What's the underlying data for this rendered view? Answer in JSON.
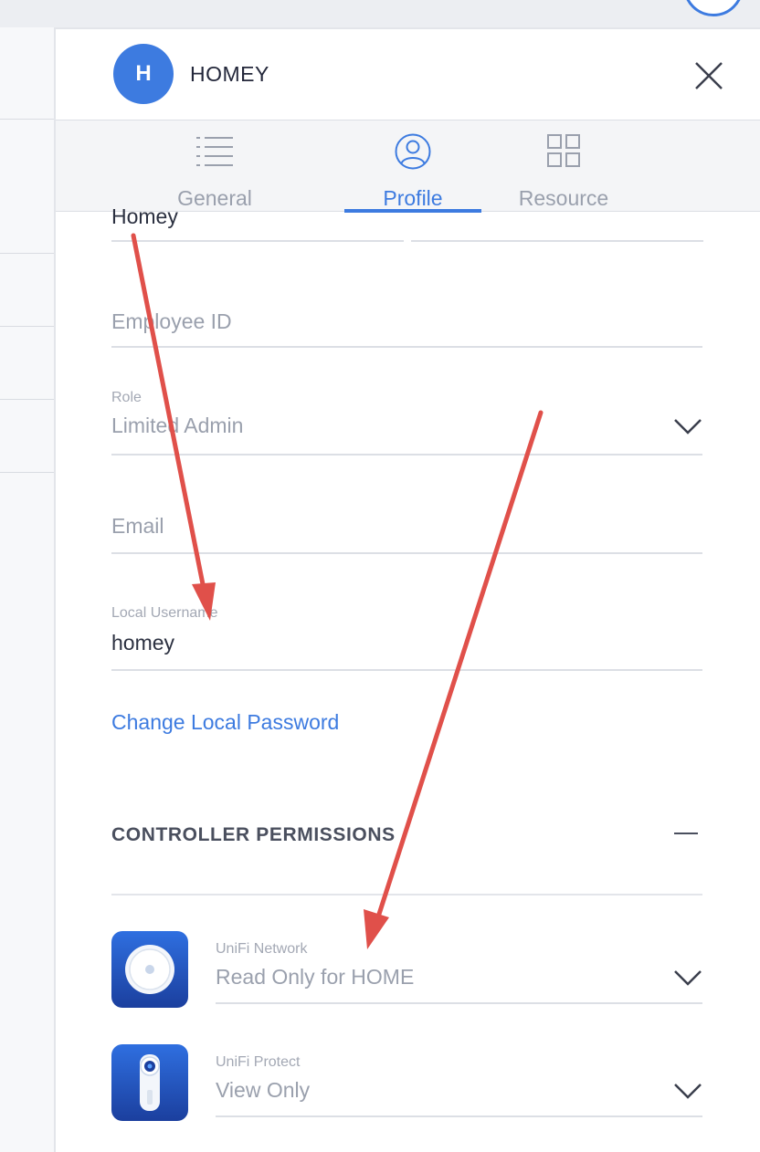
{
  "header": {
    "avatar_initial": "H",
    "title": "HOMEY"
  },
  "tabs": [
    {
      "label": "General",
      "icon": "list-icon",
      "active": false
    },
    {
      "label": "Profile",
      "icon": "person-icon",
      "active": true
    },
    {
      "label": "Resource",
      "icon": "grid-icon",
      "active": false
    }
  ],
  "form": {
    "name_value": "Homey",
    "employee_id": {
      "placeholder": "Employee ID"
    },
    "role": {
      "label": "Role",
      "value": "Limited Admin"
    },
    "email": {
      "placeholder": "Email"
    },
    "local_username": {
      "label": "Local Username",
      "value": "homey"
    },
    "change_password_link": "Change Local Password"
  },
  "permissions": {
    "section_title": "CONTROLLER PERMISSIONS",
    "items": [
      {
        "app": "UniFi Network",
        "value": "Read Only for HOME",
        "icon": "unifi-network-icon"
      },
      {
        "app": "UniFi Protect",
        "value": "View Only",
        "icon": "unifi-protect-icon"
      }
    ]
  },
  "colors": {
    "accent": "#3d7be0",
    "annotation_arrow": "#e0504a"
  }
}
